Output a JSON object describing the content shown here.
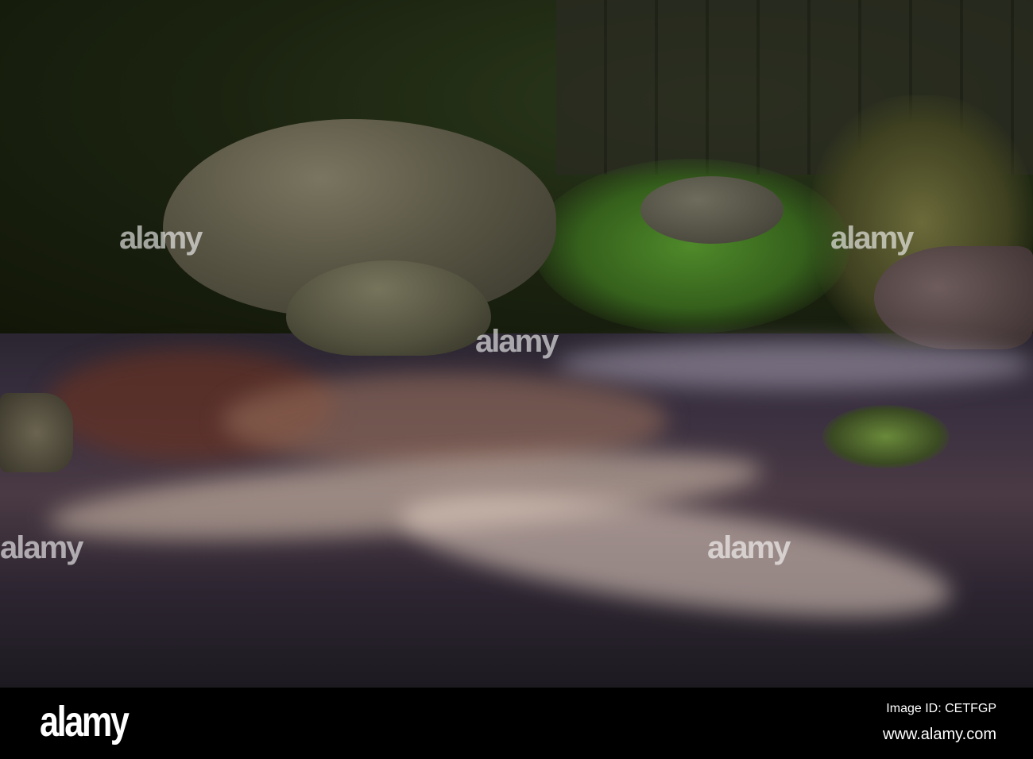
{
  "footer": {
    "logo": "alamy",
    "image_id": "Image ID: CETFGP",
    "website": "www.alamy.com"
  },
  "watermark": "alamy"
}
